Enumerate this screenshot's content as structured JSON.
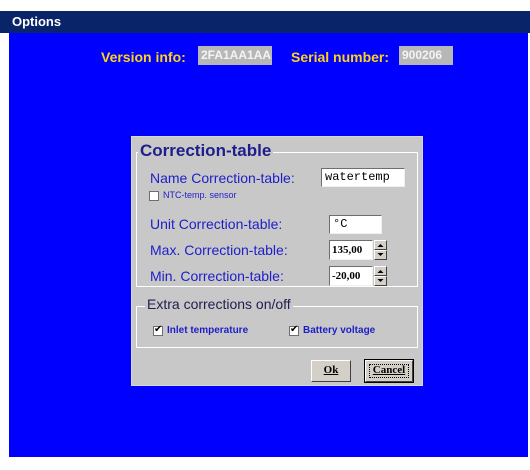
{
  "window": {
    "title": "Options"
  },
  "header": {
    "version_label": "Version info:",
    "version_value": "2FA1AA1AA",
    "serial_label": "Serial number:",
    "serial_value": "900206"
  },
  "correction_table": {
    "title": "Correction-table",
    "name_label": "Name Correction-table:",
    "name_value": "watertemp",
    "ntc_label": "NTC-temp. sensor",
    "ntc_checked": false,
    "unit_label": "Unit Correction-table:",
    "unit_value": "°C",
    "max_label": "Max. Correction-table:",
    "max_value": "135,00",
    "min_label": "Min. Correction-table:",
    "min_value": "-20,00"
  },
  "extra_corrections": {
    "title": "Extra corrections on/off",
    "inlet_label": "Inlet temperature",
    "inlet_checked": true,
    "battery_label": "Battery voltage",
    "battery_checked": true
  },
  "buttons": {
    "ok": "Ok",
    "cancel": "Cancel"
  },
  "colors": {
    "background": "#0000ff",
    "titlebar": "#0a246a",
    "label_yellow": "#ffd21a",
    "label_blue": "#1e1ec8",
    "panel": "#c8c8c8"
  }
}
